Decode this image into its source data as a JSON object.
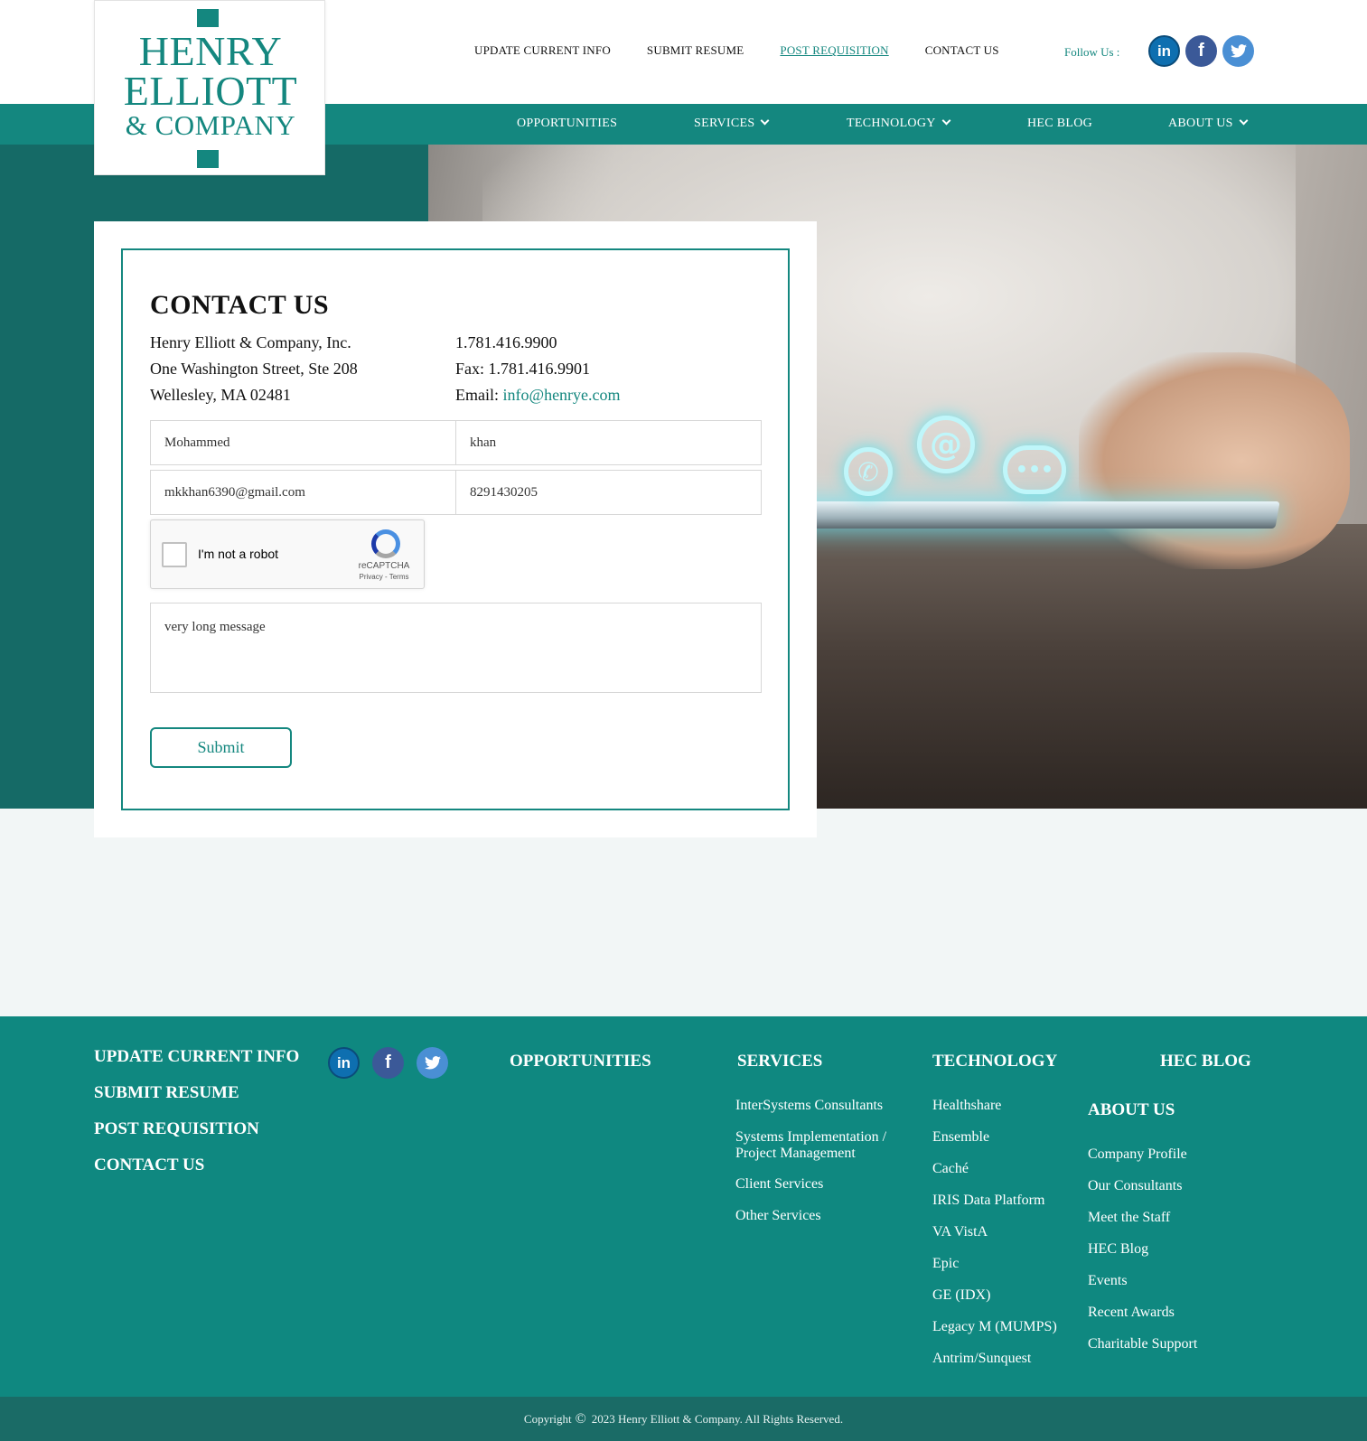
{
  "logo": {
    "line1": "HENRY",
    "line2": "ELLIOTT",
    "line3": "& COMPANY"
  },
  "topnav": [
    {
      "label": "UPDATE CURRENT INFO"
    },
    {
      "label": "SUBMIT RESUME"
    },
    {
      "label": "POST REQUISITION"
    },
    {
      "label": "CONTACT US"
    }
  ],
  "follow_label": "Follow Us :",
  "social_icons": [
    "linkedin-icon",
    "facebook-icon",
    "twitter-icon"
  ],
  "mainnav": {
    "opportunities": "OPPORTUNITIES",
    "services": "SERVICES",
    "technology": "TECHNOLOGY",
    "blog": "HEC BLOG",
    "about": "ABOUT US"
  },
  "contact": {
    "title": "CONTACT US",
    "company": "Henry Elliott & Company, Inc.",
    "street": "One Washington Street, Ste 208",
    "city": "Wellesley, MA 02481",
    "phone": "1.781.416.9900",
    "fax": "Fax: 1.781.416.9901",
    "email_label": "Email:",
    "email": "info@henrye.com"
  },
  "form": {
    "first_name": "Mohammed",
    "last_name": "khan",
    "email": "mkkhan6390@gmail.com",
    "phone": "8291430205",
    "message": "very long message",
    "submit_label": "Submit"
  },
  "captcha": {
    "label": "I'm not a robot",
    "brand": "reCAPTCHA",
    "terms": "Privacy - Terms"
  },
  "footer": {
    "links": [
      "UPDATE CURRENT INFO",
      "SUBMIT RESUME",
      "POST REQUISITION",
      "CONTACT US"
    ],
    "opportunities": "OPPORTUNITIES",
    "services_head": "SERVICES",
    "services": [
      "InterSystems Consultants",
      "Systems Implementation / Project Management",
      "Client Services",
      "Other Services"
    ],
    "technology_head": "TECHNOLOGY",
    "technology": [
      "Healthshare",
      "Ensemble",
      "Caché",
      "IRIS Data Platform",
      "VA VistA",
      "Epic",
      "GE (IDX)",
      "Legacy M (MUMPS)",
      "Antrim/Sunquest"
    ],
    "blog_head": "HEC BLOG",
    "about_head": "ABOUT US",
    "about": [
      "Company Profile",
      "Our Consultants",
      "Meet the Staff",
      "HEC Blog",
      "Events",
      "Recent Awards",
      "Charitable Support"
    ],
    "copyright_prefix": "Copyright",
    "copyright_symbol": "©",
    "copyright_text": "2023 Henry Elliott & Company. All Rights Reserved."
  },
  "colors": {
    "teal": "#14877f",
    "dark_teal": "#156a66",
    "footer": "#0f8880"
  }
}
